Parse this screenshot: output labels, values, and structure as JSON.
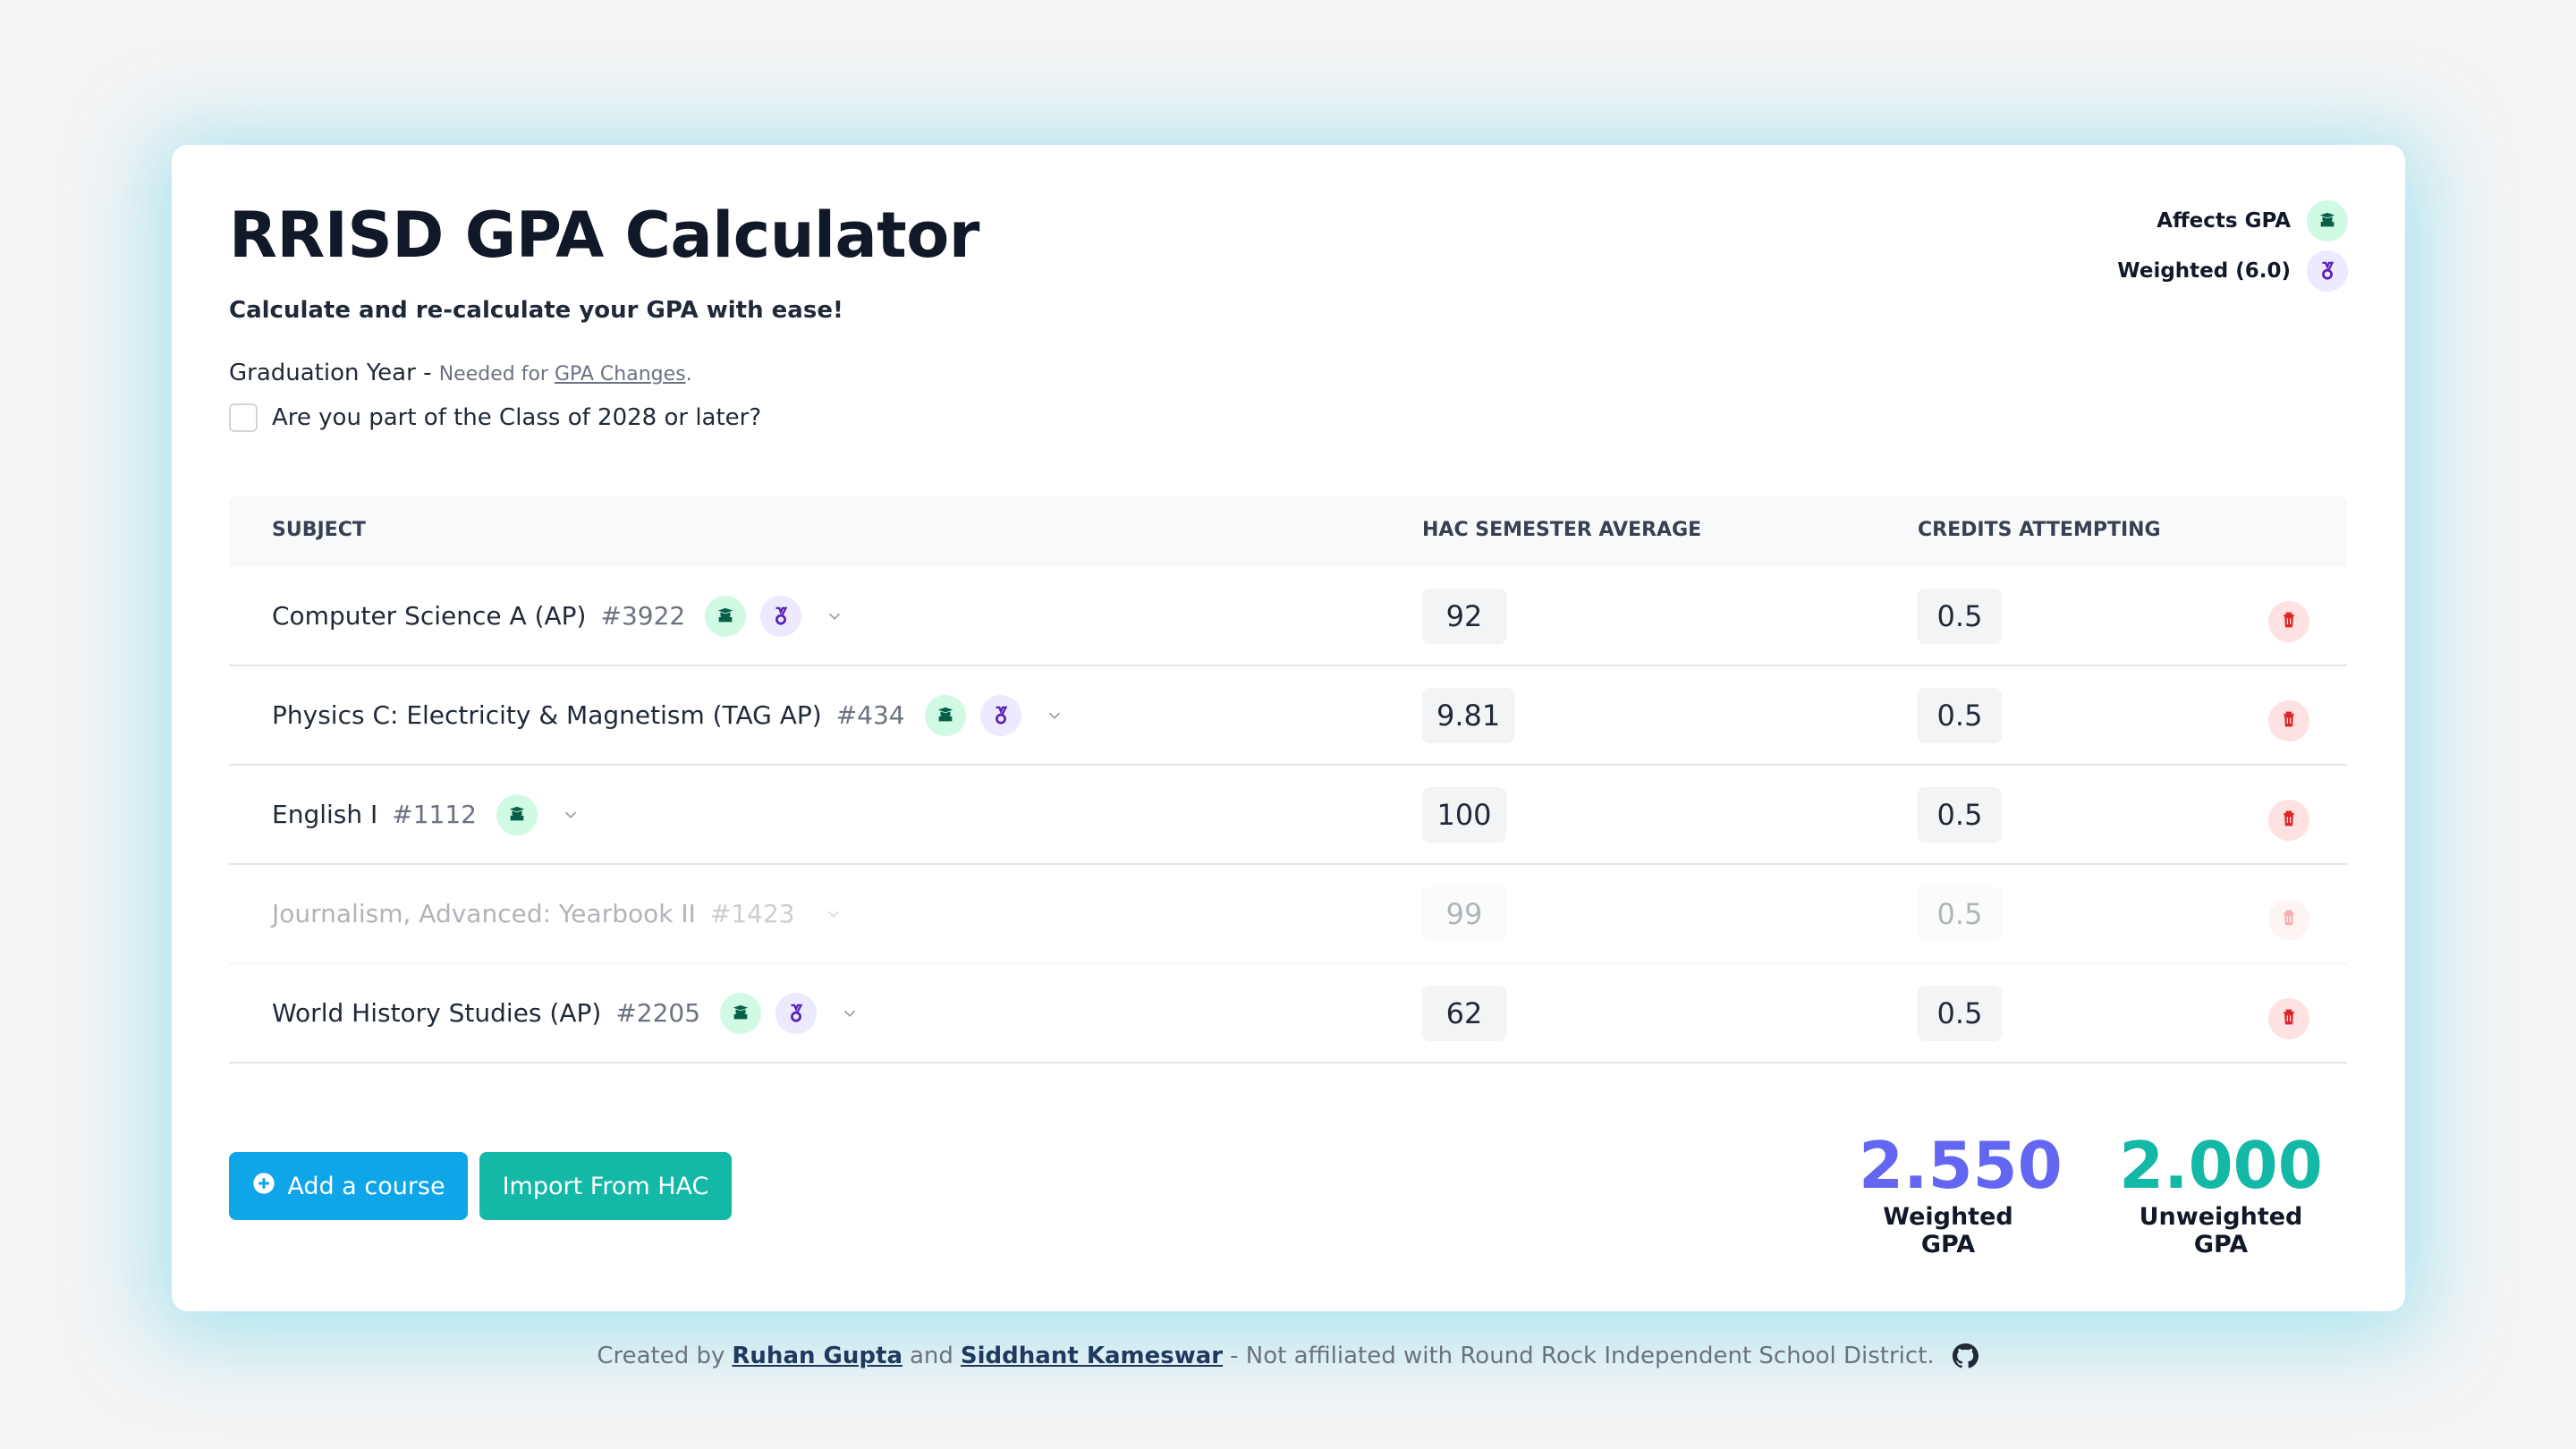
{
  "header": {
    "title": "RRISD GPA Calculator",
    "subtitle": "Calculate and re-calculate your GPA with ease!",
    "grad_label": "Graduation Year - ",
    "grad_note": "Needed for ",
    "grad_link": "GPA Changes",
    "grad_note_end": ".",
    "class_question": "Are you part of the Class of 2028 or later?"
  },
  "legend": {
    "affects": "Affects GPA",
    "weighted": "Weighted (6.0)"
  },
  "table": {
    "headers": {
      "subject": "SUBJECT",
      "average": "HAC SEMESTER AVERAGE",
      "credits": "CREDITS ATTEMPTING"
    },
    "rows": [
      {
        "name": "Computer Science A (AP)",
        "code": "#3922",
        "average": "92",
        "credits": "0.5"
      },
      {
        "name": "Physics C: Electricity & Magnetism (TAG AP)",
        "code": "#434",
        "average": "9.81",
        "credits": "0.5"
      },
      {
        "name": "English I",
        "code": "#1112",
        "average": "100",
        "credits": "0.5"
      },
      {
        "name": "Journalism, Advanced: Yearbook II",
        "code": "#1423",
        "average": "99",
        "credits": "0.5"
      },
      {
        "name": "World History Studies (AP)",
        "code": "#2205",
        "average": "62",
        "credits": "0.5"
      }
    ]
  },
  "actions": {
    "add": "Add a course",
    "import": "Import From HAC"
  },
  "results": {
    "weighted_value": "2.550",
    "weighted_label": "Weighted GPA",
    "unweighted_value": "2.000",
    "unweighted_label": "Unweighted GPA"
  },
  "footer": {
    "created_by": "Created by",
    "author1": "Ruhan Gupta",
    "and": "and",
    "author2": "Siddhant Kameswar",
    "disclaimer": "- Not affiliated with Round Rock Independent School District."
  },
  "colors": {
    "accent_blue": "#0ea5e9",
    "accent_teal": "#14b8a6",
    "weighted_purple": "#6366f1",
    "badge_green": "#d1fae5",
    "badge_purple": "#ede9fe",
    "delete_red": "#dc2626"
  }
}
